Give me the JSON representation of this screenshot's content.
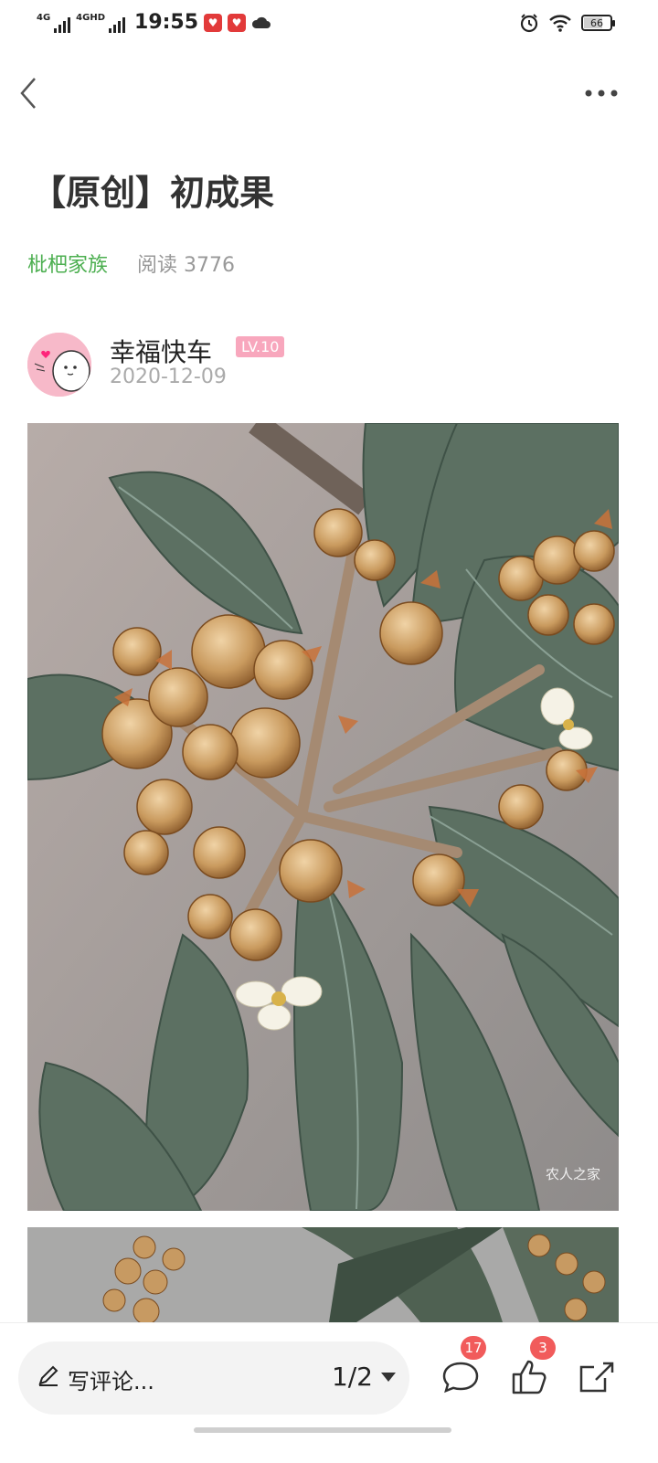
{
  "status_bar": {
    "network_1": "4G",
    "network_2": "4GHD",
    "time": "19:55",
    "battery_level": "66"
  },
  "article": {
    "title": "【原创】初成果",
    "category": "枇杷家族",
    "reads_label": "阅读 3776"
  },
  "author": {
    "name": "幸福快车",
    "level": "LV.10",
    "date": "2020-12-09"
  },
  "photo": {
    "watermark": "农人之家"
  },
  "bottom_bar": {
    "comment_placeholder": "写评论...",
    "page_indicator": "1/2",
    "comment_count": "17",
    "like_count": "3"
  },
  "colors": {
    "accent_green": "#4caf50",
    "badge_red": "#f15b5b",
    "level_pink": "#f8a7bd"
  },
  "icons": [
    "back-icon",
    "more-icon",
    "pen-icon",
    "dropdown-icon",
    "comment-icon",
    "like-icon",
    "share-icon",
    "wifi-icon",
    "alarm-icon",
    "cloud-icon"
  ]
}
